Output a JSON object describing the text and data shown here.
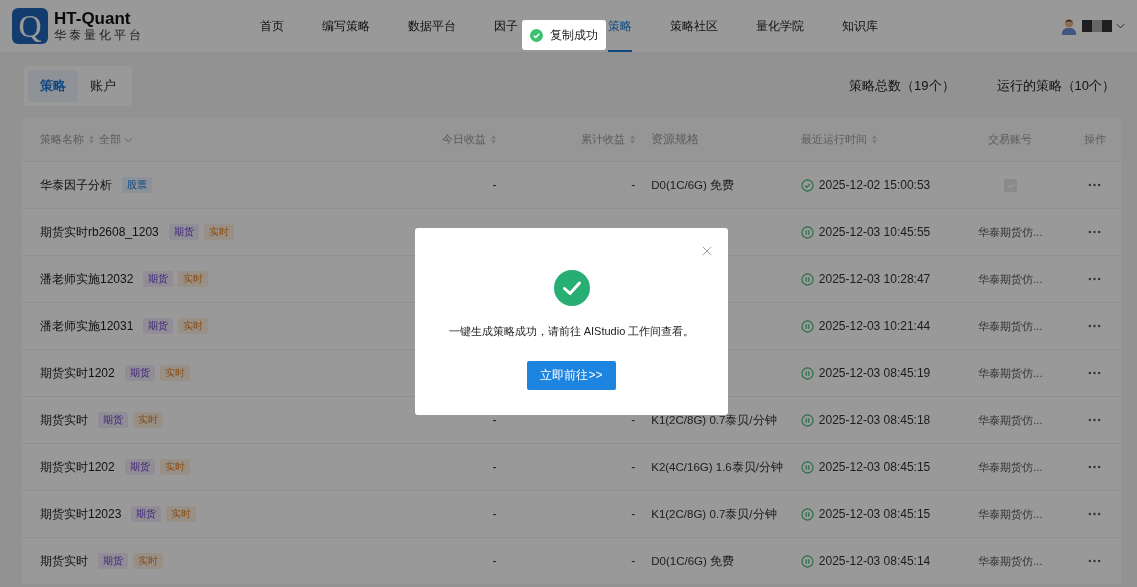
{
  "header": {
    "logo_letter": "Q",
    "title": "HT-Quant",
    "subtitle": "华泰量化平台",
    "nav": [
      {
        "label": "首页",
        "selected": false
      },
      {
        "label": "编写策略",
        "selected": false
      },
      {
        "label": "数据平台",
        "selected": false
      },
      {
        "label": "因子",
        "selected": false
      },
      {
        "label": "策略",
        "selected": true
      },
      {
        "label": "策略社区",
        "selected": false
      },
      {
        "label": "量化学院",
        "selected": false
      },
      {
        "label": "知识库",
        "selected": false
      }
    ]
  },
  "toast": {
    "text": "复制成功"
  },
  "subtabs": [
    {
      "label": "策略",
      "selected": true
    },
    {
      "label": "账户",
      "selected": false
    }
  ],
  "stats": [
    "策略总数（19个）",
    "运行的策略（10个）"
  ],
  "table": {
    "columns": [
      {
        "label": "策略名称",
        "sortable": true,
        "filter": "全部"
      },
      {
        "label": "今日收益",
        "sortable": true
      },
      {
        "label": "累计收益",
        "sortable": true
      },
      {
        "label": "资源规格",
        "sortable": false
      },
      {
        "label": "最近运行时间",
        "sortable": true
      },
      {
        "label": "交易账号",
        "sortable": false
      },
      {
        "label": "操作",
        "sortable": false
      }
    ],
    "rows": [
      {
        "name": "华泰因子分析",
        "tags": [
          {
            "label": "股票",
            "kind": "stock"
          }
        ],
        "today": "-",
        "total": "-",
        "resource": "D0(1C/6G) 免费",
        "running": false,
        "time": "2025-12-02 15:00:53"
      },
      {
        "name": "期货实时rb2608_1203",
        "tags": [
          {
            "label": "期货",
            "kind": "futures"
          },
          {
            "label": "实时",
            "kind": "live"
          }
        ],
        "running": true,
        "time": "2025-12-03 10:45:55",
        "account": "华泰期货仿..."
      },
      {
        "name": "潘老师实施12032",
        "tags": [
          {
            "label": "期货",
            "kind": "futures"
          },
          {
            "label": "实时",
            "kind": "live"
          }
        ],
        "running": true,
        "time": "2025-12-03 10:28:47",
        "account": "华泰期货仿..."
      },
      {
        "name": "潘老师实施12031",
        "tags": [
          {
            "label": "期货",
            "kind": "futures"
          },
          {
            "label": "实时",
            "kind": "live"
          }
        ],
        "running": true,
        "time": "2025-12-03 10:21:44",
        "account": "华泰期货仿..."
      },
      {
        "name": "期货实时1202",
        "tags": [
          {
            "label": "期货",
            "kind": "futures"
          },
          {
            "label": "实时",
            "kind": "live"
          }
        ],
        "running": true,
        "time": "2025-12-03 08:45:19",
        "account": "华泰期货仿..."
      },
      {
        "name": "期货实时",
        "tags": [
          {
            "label": "期货",
            "kind": "futures"
          },
          {
            "label": "实时",
            "kind": "live"
          }
        ],
        "today": "-",
        "total": "-",
        "resource": "K1(2C/8G) 0.7泰贝/分钟",
        "running": true,
        "time": "2025-12-03 08:45:18",
        "account": "华泰期货仿..."
      },
      {
        "name": "期货实时1202",
        "tags": [
          {
            "label": "期货",
            "kind": "futures"
          },
          {
            "label": "实时",
            "kind": "live"
          }
        ],
        "today": "-",
        "total": "-",
        "resource": "K2(4C/16G) 1.6泰贝/分钟",
        "running": true,
        "time": "2025-12-03 08:45:15",
        "account": "华泰期货仿..."
      },
      {
        "name": "期货实时12023",
        "tags": [
          {
            "label": "期货",
            "kind": "futures"
          },
          {
            "label": "实时",
            "kind": "live"
          }
        ],
        "today": "-",
        "total": "-",
        "resource": "K1(2C/8G) 0.7泰贝/分钟",
        "running": true,
        "time": "2025-12-03 08:45:15",
        "account": "华泰期货仿..."
      },
      {
        "name": "期货实时",
        "tags": [
          {
            "label": "期货",
            "kind": "futures"
          },
          {
            "label": "实时",
            "kind": "live"
          }
        ],
        "today": "-",
        "total": "-",
        "resource": "D0(1C/6G) 免费",
        "running": true,
        "time": "2025-12-03 08:45:14",
        "account": "华泰期货仿..."
      }
    ]
  },
  "modal": {
    "message": "一键生成策略成功，请前往 AIStudio 工作间查看。",
    "button": "立即前往>>"
  }
}
